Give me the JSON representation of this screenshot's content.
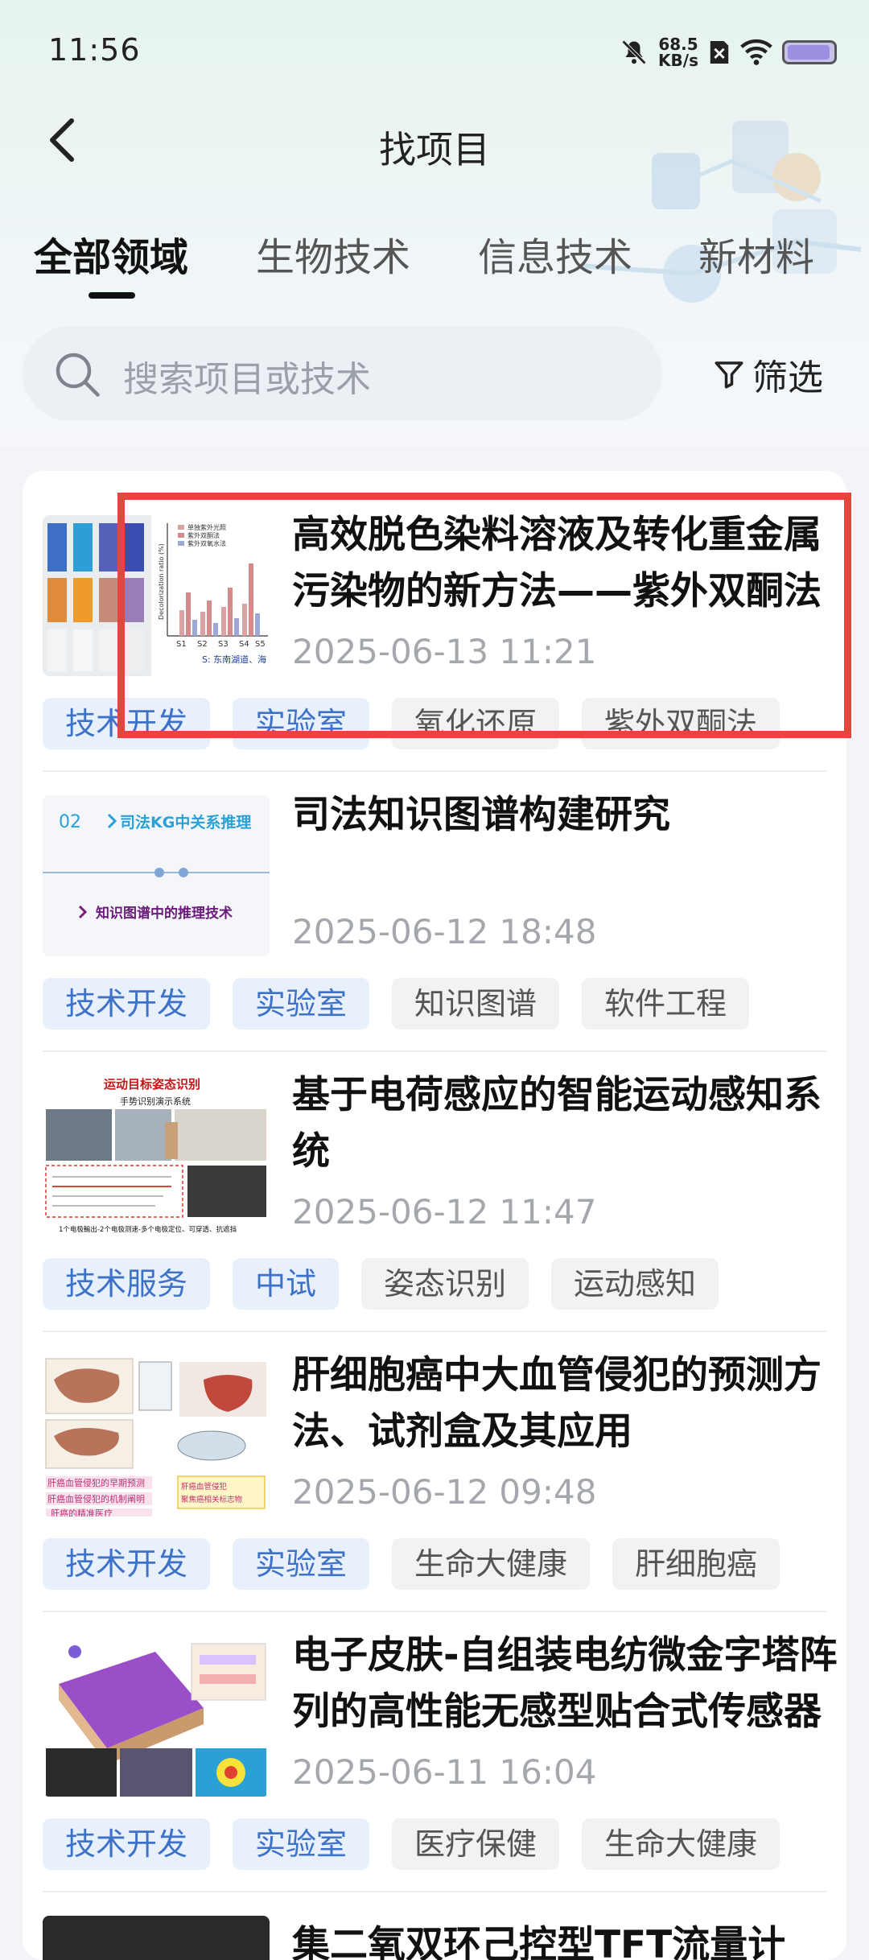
{
  "status": {
    "time": "11:56",
    "speed_value": "68.5",
    "speed_unit": "KB/s"
  },
  "nav": {
    "title": "找项目"
  },
  "tabs": [
    {
      "label": "全部领域",
      "active": true
    },
    {
      "label": "生物技术"
    },
    {
      "label": "信息技术"
    },
    {
      "label": "新材料"
    }
  ],
  "search": {
    "placeholder": "搜索项目或技术"
  },
  "filter": {
    "label": "筛选"
  },
  "items": [
    {
      "title": "高效脱色染料溶液及转化重金属污染物的新方法——紫外双酮法",
      "date": "2025-06-13 11:21",
      "tags": [
        "技术开发",
        "实验室",
        "氧化还原",
        "紫外双酮法"
      ],
      "thumb": {
        "legend": [
          "单独紫外光照",
          "紫外双酮法",
          "紫外双氧水法"
        ],
        "ylabel": "Decolorization ratio (%)",
        "xticks": [
          "S1",
          "S2",
          "S3",
          "S4",
          "S5"
        ],
        "note": "S: 东南湖道、海"
      }
    },
    {
      "title": "司法知识图谱构建研究",
      "date": "2025-06-12 18:48",
      "tags": [
        "技术开发",
        "实验室",
        "知识图谱",
        "软件工程"
      ],
      "thumb": {
        "num": "02",
        "heading": "司法KG中关系推理",
        "sub": "知识图谱中的推理技术"
      }
    },
    {
      "title": "基于电荷感应的智能运动感知系统",
      "date": "2025-06-12 11:47",
      "tags": [
        "技术服务",
        "中试",
        "姿态识别",
        "运动感知"
      ],
      "thumb": {
        "heading": "运动目标姿态识别",
        "sub": "手势识别演示系统",
        "foot": "1个电极輸出-2个电极测速-多个电极定位、可穿透、抗遮挡"
      }
    },
    {
      "title": "肝细胞癌中大血管侵犯的预测方法、试剂盒及其应用",
      "date": "2025-06-12 09:48",
      "tags": [
        "技术开发",
        "实验室",
        "生命大健康",
        "肝细胞癌"
      ],
      "thumb": {
        "line1": "肝癌血管侵犯的早期预测",
        "line2": "肝癌血管侵犯的机制阐明",
        "line3": "肝癌的精准医疗",
        "box": "肝癌血管侵犯\n聚焦癌相关标志物"
      }
    },
    {
      "title": "电子皮肤-自组装电纺微金字塔阵列的高性能无感型贴合式传感器",
      "date": "2025-06-11 16:04",
      "tags": [
        "技术开发",
        "实验室",
        "医疗保健",
        "生命大健康"
      ],
      "thumb": {}
    }
  ],
  "peek_title": "集二氧双环己控型TFT流量计",
  "colors": {
    "highlight": "#e4463f",
    "tag_blue_bg": "#e8f0fb",
    "tag_blue_text": "#3d72c8"
  }
}
